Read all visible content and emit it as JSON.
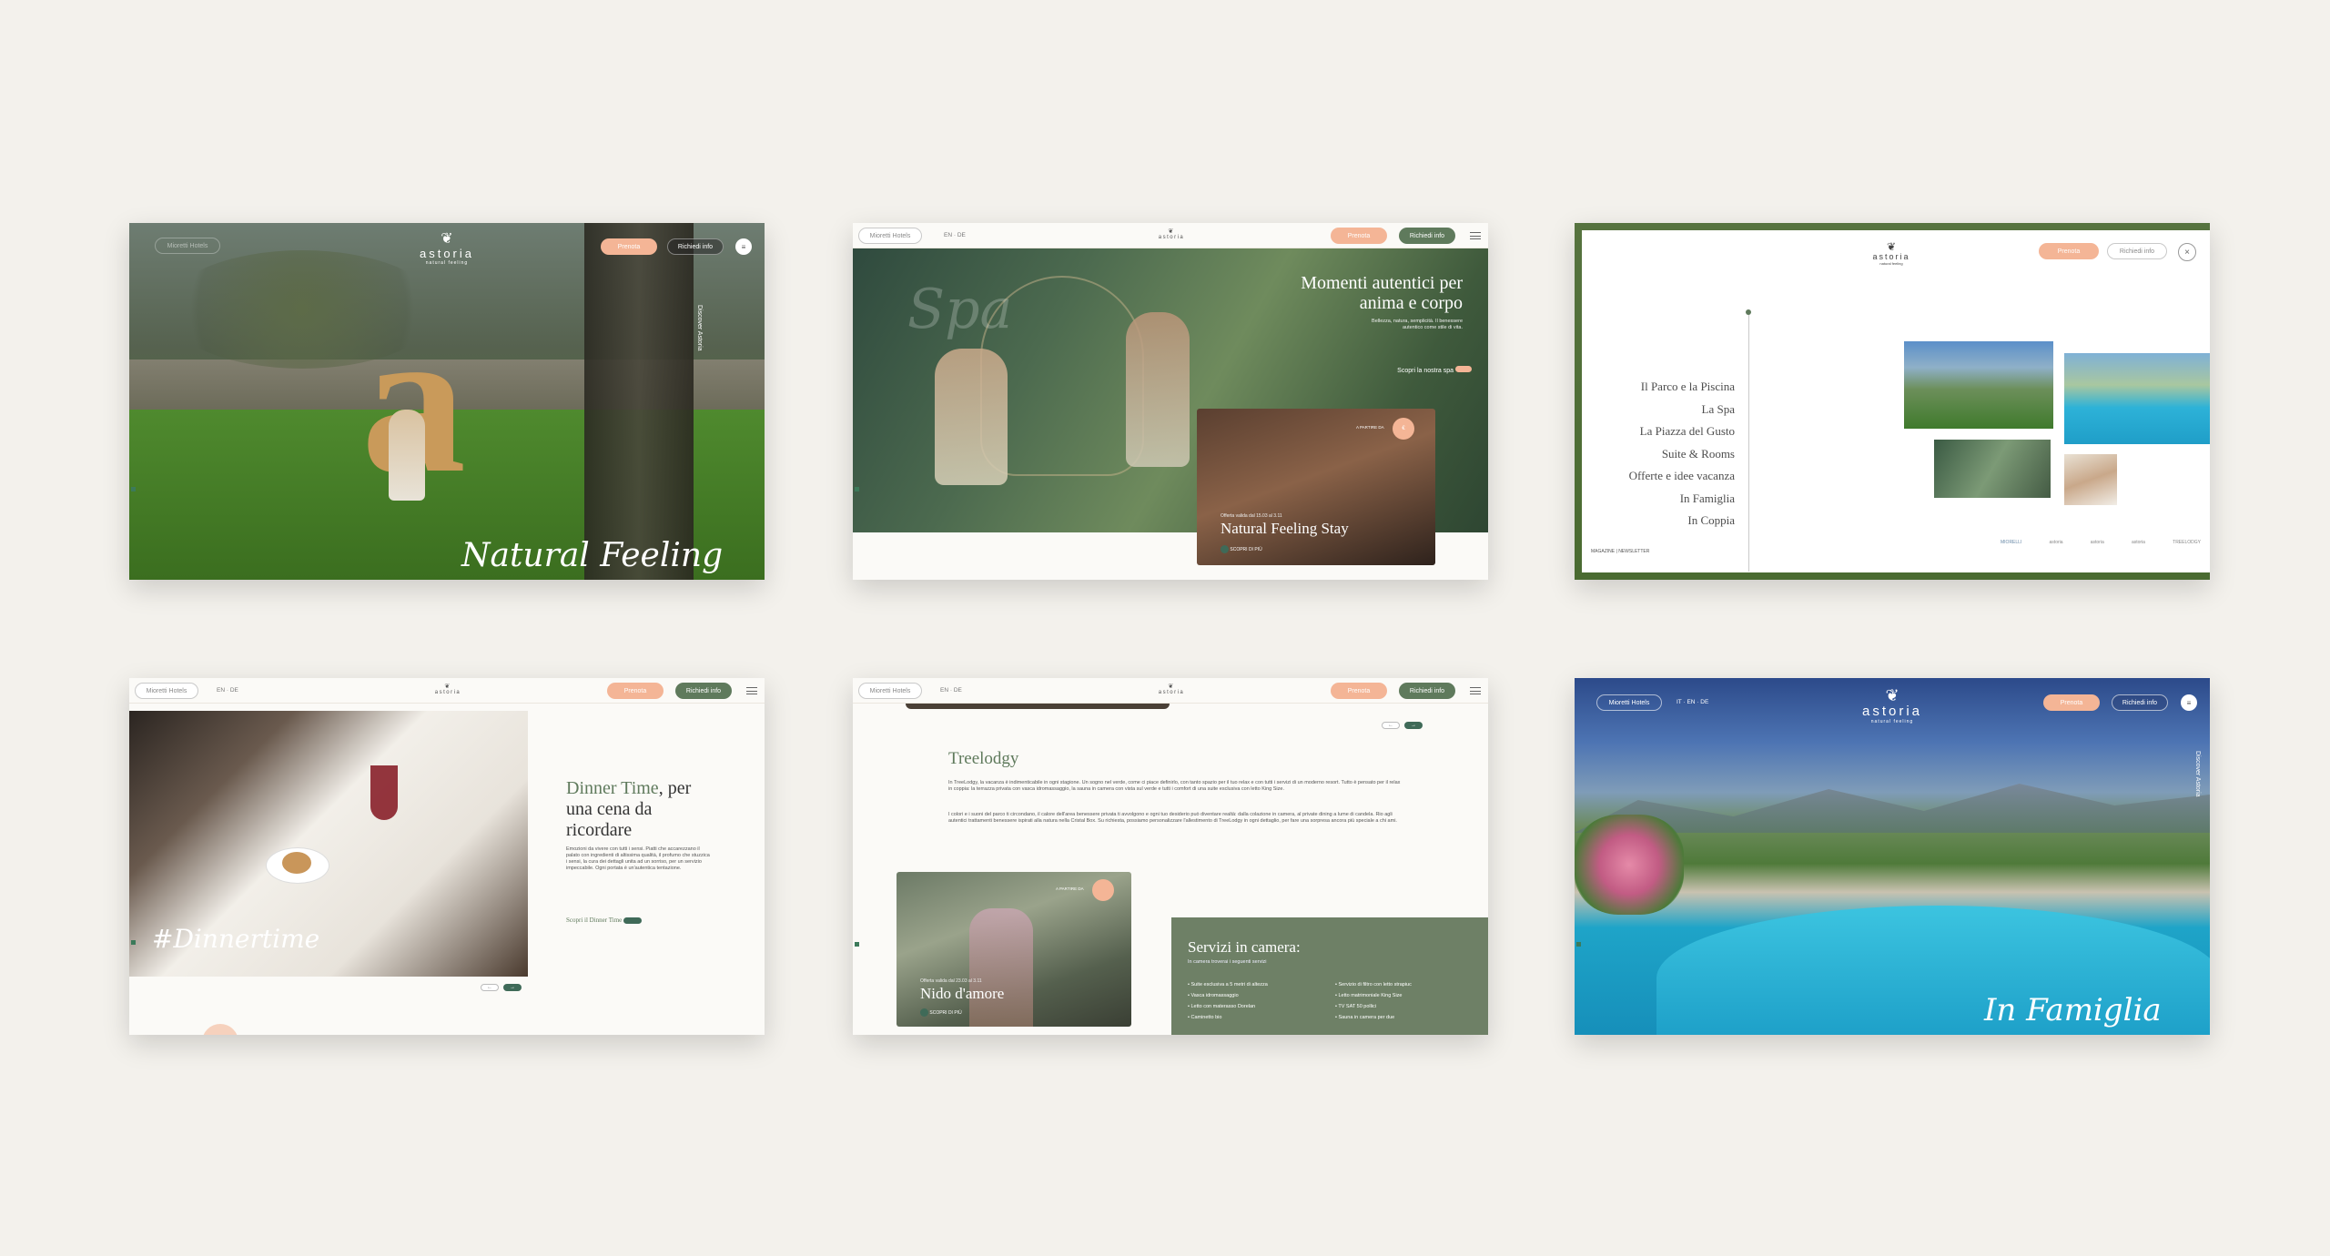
{
  "brand": {
    "name": "astoria",
    "tagline": "natural feeling"
  },
  "colors": {
    "peach": "#f4b596",
    "green": "#5f7a5c",
    "background": "#f3f1ec"
  },
  "nav": {
    "book": "Prenota",
    "info": "Richiedi info",
    "hotels": "Mioretti Hotels",
    "lang_en": "EN",
    "lang_de": "DE",
    "lang_it": "IT",
    "discover": "Discover Astoria"
  },
  "card1": {
    "script": "Natural Feeling"
  },
  "card2": {
    "script": "Spa",
    "title_line1": "Momenti autentici per",
    "title_line2": "anima e corpo",
    "desc": "Bellezza, natura, semplicità. Il benessere autentico come stile di vita.",
    "link": "Scopri la nostra spa",
    "offer_badge": "A PARTIRE DA",
    "offer_price": "€",
    "offer_validity": "Offerta valida dal 15.03 al 3.11",
    "offer_title": "Natural Feeling Stay",
    "offer_more": "SCOPRI DI PIÙ"
  },
  "card3": {
    "menu": [
      "Il Parco e la Piscina",
      "La Spa",
      "La Piazza del Gusto",
      "Suite & Rooms",
      "Offerte e idee vacanza",
      "In Famiglia",
      "In Coppia"
    ],
    "footer_links": "MAGAZINE | NEWSLETTER",
    "partner_logos": [
      "MIORELLI",
      "astoria",
      "astoria",
      "astoria",
      "TREELODGY"
    ]
  },
  "card4": {
    "title_part1": "Dinner Time",
    "title_part2": ", per",
    "title_line2": "una cena da",
    "title_line3": "ricordare",
    "body": "Emozioni da vivere con tutti i sensi. Piatti che accarezzano il palato con ingredienti di altissima qualità, il profumo che stuzzica i sensi, la cura dei dettagli unita ad un sorriso, per un servizio impeccabile. Ogni portata è un'autentica tentazione.",
    "link": "Scopri il Dinner Time",
    "script": "#Dinnertime"
  },
  "card5": {
    "title": "Treelodgy",
    "para1": "In TreeLodgy, la vacanza è indimenticabile in ogni stagione. Un sogno nel verde, come ci piace definirlo, con tanto spazio per il tuo relax e con tutti i servizi di un moderno resort. Tutto è pensato per il relax in coppia: la terrazza privata con vasca idromassaggio, la sauna in camera con vista sul verde e tutti i comfort di una suite esclusiva con letto King Size.",
    "para2": "I colori e i suoni del parco ti circondano, il calore dell'area benessere privata ti avvolgono e ogni tuo desiderio può diventare realtà: dalla colazione in camera, al private dining a lume di candela. Rio agli autentici trattamenti benessere ispirati alla natura nella Cristal Box. Su richiesta, possiamo personalizzare l'allestimento di TreeLodgy in ogni dettaglio, per fare una sorpresa ancora più speciale a chi ami.",
    "offer_badge": "A PARTIRE DA",
    "offer_validity": "Offerta valida dal 23.03 al 3.11",
    "offer_title": "Nido d'amore",
    "offer_more": "SCOPRI DI PIÙ",
    "services_title": "Servizi in camera:",
    "services_sub": "In camera troverai i seguenti servizi",
    "services_left": [
      "Suite esclusiva a 5 metri di altezza",
      "Vasca idromassaggio",
      "Letto con materasso Dorelan",
      "Caminetto bio"
    ],
    "services_right": [
      "Servizio di filtro con letto strapiuc",
      "Letto matrimoniale King Size",
      "TV SAT 50 pollici",
      "Sauna in camera per due"
    ]
  },
  "card6": {
    "script": "In Famiglia"
  }
}
